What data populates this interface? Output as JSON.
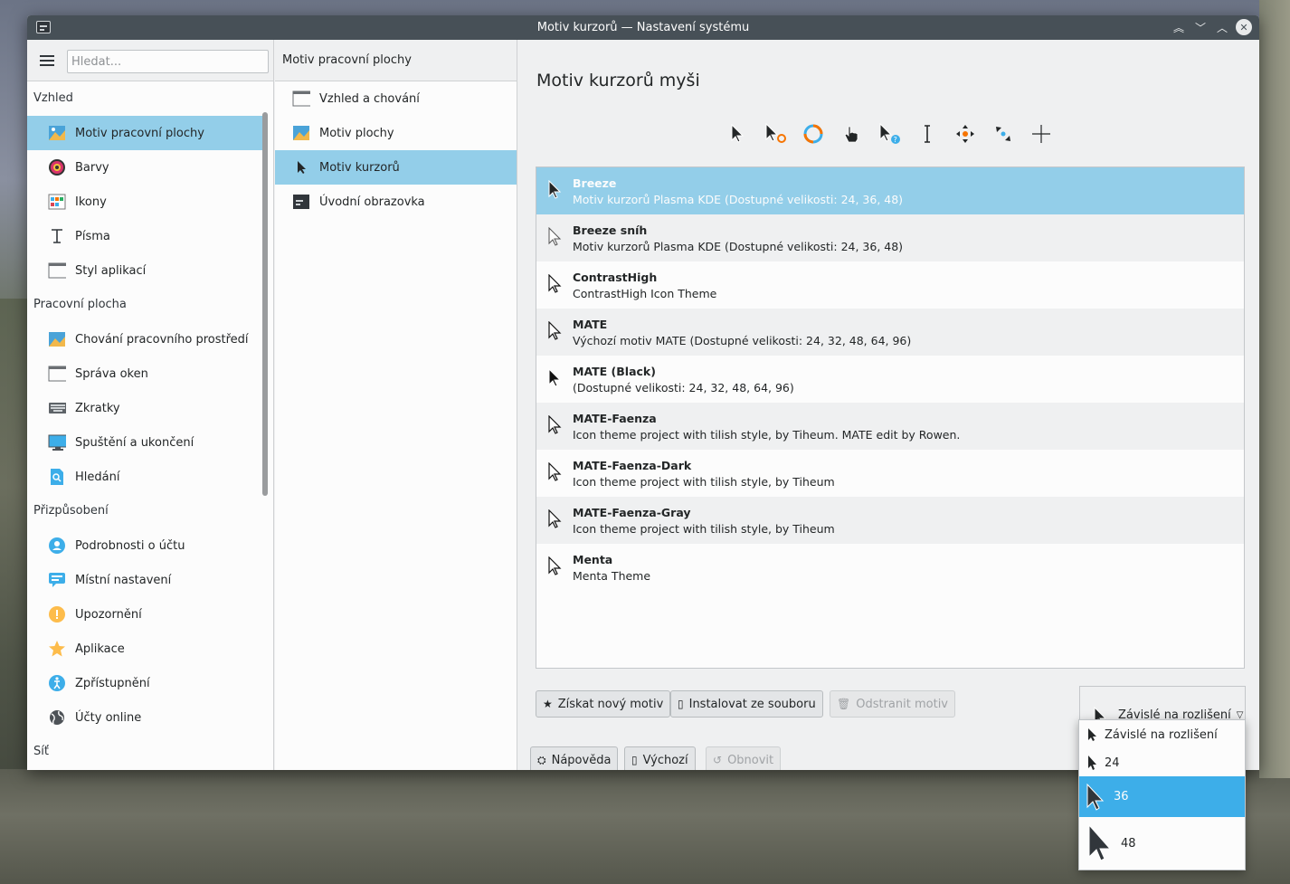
{
  "window": {
    "title": "Motiv kurzorů — Nastavení systému"
  },
  "sidebar": {
    "search_placeholder": "Hledat...",
    "sections": [
      {
        "title": "Vzhled",
        "items": [
          {
            "label": "Motiv pracovní plochy",
            "icon": "desktop-theme-icon",
            "selected": true
          },
          {
            "label": "Barvy",
            "icon": "colors-icon"
          },
          {
            "label": "Ikony",
            "icon": "icons-icon"
          },
          {
            "label": "Písma",
            "icon": "fonts-icon"
          },
          {
            "label": "Styl aplikací",
            "icon": "app-style-icon"
          }
        ]
      },
      {
        "title": "Pracovní plocha",
        "items": [
          {
            "label": "Chování pracovního prostředí",
            "icon": "workspace-behavior-icon"
          },
          {
            "label": "Správa oken",
            "icon": "window-management-icon"
          },
          {
            "label": "Zkratky",
            "icon": "keyboard-icon"
          },
          {
            "label": "Spuštění a ukončení",
            "icon": "startup-icon"
          },
          {
            "label": "Hledání",
            "icon": "search-file-icon"
          }
        ]
      },
      {
        "title": "Přizpůsobení",
        "items": [
          {
            "label": "Podrobnosti o účtu",
            "icon": "user-icon"
          },
          {
            "label": "Místní nastavení",
            "icon": "locale-icon"
          },
          {
            "label": "Upozornění",
            "icon": "notification-icon"
          },
          {
            "label": "Aplikace",
            "icon": "star-icon"
          },
          {
            "label": "Zpřístupnění",
            "icon": "accessibility-icon"
          },
          {
            "label": "Účty online",
            "icon": "globe-icon"
          }
        ]
      },
      {
        "title": "Síť",
        "items": []
      }
    ]
  },
  "midpane": {
    "title": "Motiv pracovní plochy",
    "items": [
      {
        "label": "Vzhled a chování",
        "icon": "look-and-feel-icon"
      },
      {
        "label": "Motiv plochy",
        "icon": "plasma-theme-icon"
      },
      {
        "label": "Motiv kurzorů",
        "icon": "cursor-icon",
        "selected": true
      },
      {
        "label": "Úvodní obrazovka",
        "icon": "splash-screen-icon"
      }
    ]
  },
  "main": {
    "title": "Motiv kurzorů myši",
    "themes": [
      {
        "name": "Breeze",
        "desc": "Motiv kurzorů Plasma KDE (Dostupné velikosti: 24, 36, 48)",
        "selected": true
      },
      {
        "name": "Breeze sníh",
        "desc": "Motiv kurzorů Plasma KDE (Dostupné velikosti: 24, 36, 48)"
      },
      {
        "name": "ContrastHigh",
        "desc": "ContrastHigh Icon Theme"
      },
      {
        "name": "MATE",
        "desc": "Výchozí motiv MATE (Dostupné velikosti: 24, 32, 48, 64, 96)"
      },
      {
        "name": "MATE (Black)",
        "desc": "(Dostupné velikosti: 24, 32, 48, 64, 96)"
      },
      {
        "name": "MATE-Faenza",
        "desc": "Icon theme project with tilish style, by Tiheum. MATE edit by Rowen."
      },
      {
        "name": "MATE-Faenza-Dark",
        "desc": "Icon theme project with tilish style, by Tiheum"
      },
      {
        "name": "MATE-Faenza-Gray",
        "desc": "Icon theme project with tilish style, by Tiheum"
      },
      {
        "name": "Menta",
        "desc": "Menta Theme"
      }
    ],
    "buttons": {
      "get_new": "Získat nový motiv",
      "install_file": "Instalovat ze souboru",
      "remove": "Odstranit motiv",
      "help": "Nápověda",
      "defaults": "Výchozí",
      "reset": "Obnovit"
    },
    "size_combo": {
      "value": "Závislé na rozlišení"
    },
    "size_options": [
      {
        "label": "Závislé na rozlišení"
      },
      {
        "label": "24"
      },
      {
        "label": "36",
        "selected": true
      },
      {
        "label": "48"
      }
    ]
  },
  "colors": {
    "selection": "#93cee9",
    "highlight": "#3daee9",
    "titlebar": "#475057"
  }
}
